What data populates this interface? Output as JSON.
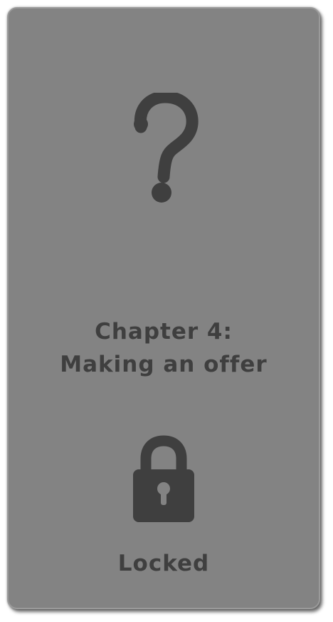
{
  "card": {
    "state": "locked",
    "chapter_line": "Chapter 4:",
    "chapter_name": "Making an offer",
    "status_label": "Locked",
    "question_icon": "question-mark-icon",
    "lock_icon": "padlock-icon"
  },
  "colors": {
    "card_background": "#838383",
    "card_border": "#9a9a9a",
    "foreground": "#3f3f3f"
  }
}
